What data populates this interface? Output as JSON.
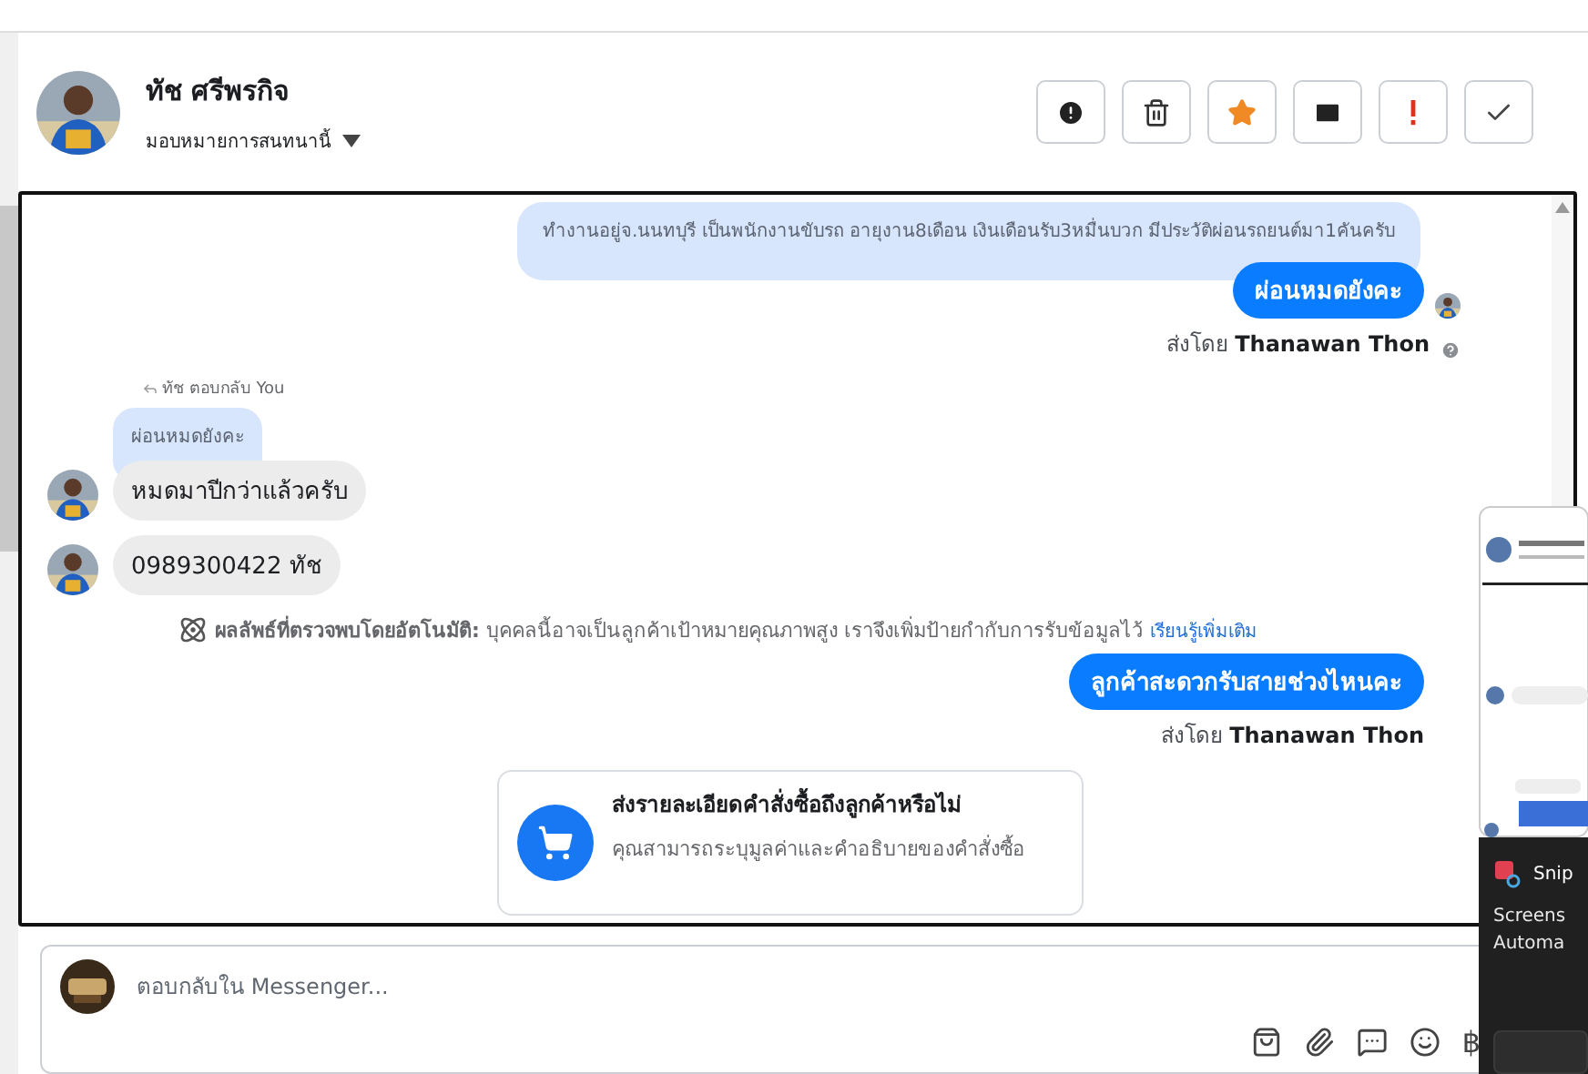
{
  "header": {
    "name": "ทัช ศรีพรกิจ",
    "assign_label": "มอบหมายการสนทนานี้"
  },
  "messages": [
    {
      "kind": "context",
      "text": "ทำงานอยู่จ.นนทบุรี เป็นพนักงานขับรถ อายุงาน8เดือน เงินเดือนรับ3หมื่นบวก มีประวัติผ่อนรถยนต์มา1คันครับ"
    },
    {
      "kind": "outgoing",
      "text": "ผ่อนหมดยังคะ",
      "seen": true
    },
    {
      "kind": "sent_by",
      "prefix": "ส่งโดย",
      "author": "Thanawan Thon",
      "help": true
    },
    {
      "kind": "reply_label",
      "text": "ทัช ตอบกลับ You"
    },
    {
      "kind": "quoted",
      "text": "ผ่อนหมดยังคะ"
    },
    {
      "kind": "incoming",
      "text": "หมดมาปีกว่าแล้วครับ"
    },
    {
      "kind": "incoming",
      "text": "0989300422 ทัช"
    },
    {
      "kind": "notice",
      "text": "**ผลลัพธ์ที่ตรวจพบโดยอัตโนมัติ:** บุคคลนี้อาจเป็นลูกค้าเป้าหมายคุณภาพสูง เราจึงเพิ่มป้ายกำกับการรับข้อมูลไว้",
      "link": "เรียนรู้เพิ่มเติม"
    },
    {
      "kind": "outgoing",
      "text": "ลูกค้าสะดวกรับสายช่วงไหนคะ",
      "seen": false
    },
    {
      "kind": "sent_by",
      "prefix": "ส่งโดย",
      "author": "Thanawan Thon",
      "help": false
    },
    {
      "kind": "order_card",
      "title": "ส่งรายละเอียดคำสั่งซื้อถึงลูกค้าหรือไม่",
      "body": "คุณสามารถระบุมูลค่าและคำอธิบายของคำสั่งซื้อ"
    }
  ],
  "composer": {
    "placeholder": "ตอบกลับใน Messenger...",
    "currency_icon": "฿"
  },
  "notification": {
    "app": "Snip",
    "title": "Screens",
    "body": "Automa"
  }
}
